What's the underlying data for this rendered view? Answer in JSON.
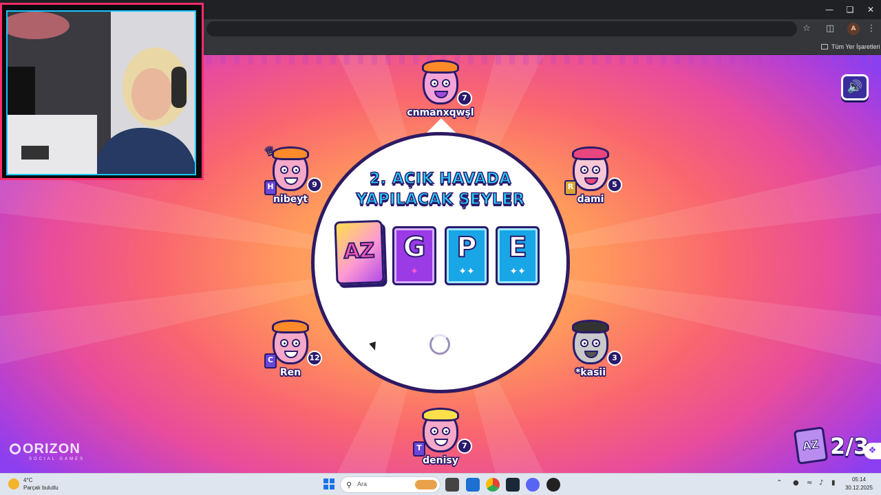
{
  "browser": {
    "bookmarks_label": "Tüm Yer İşaretleri",
    "profile_initial": "A"
  },
  "game": {
    "prompt_line1": "2. AÇIK HAVADA",
    "prompt_line2": "YAPILACAK ŞEYLER",
    "cards": [
      {
        "letter": "AZ",
        "stars": ""
      },
      {
        "letter": "G",
        "stars": "✦"
      },
      {
        "letter": "P",
        "stars": "✦✦"
      },
      {
        "letter": "E",
        "stars": "✦✦"
      }
    ],
    "players": [
      {
        "name": "cnmanxqwşl",
        "score": "7",
        "tile": ""
      },
      {
        "name": "nibeyt",
        "score": "9",
        "tile": "H"
      },
      {
        "name": "dami",
        "score": "5",
        "tile": "R"
      },
      {
        "name": "Ren",
        "score": "12",
        "tile": "C"
      },
      {
        "name": "*kasii",
        "score": "3",
        "tile": ""
      },
      {
        "name": "denisy",
        "score": "7",
        "tile": "T"
      }
    ],
    "round_icon": "AZ",
    "round_text": "2/3",
    "logo_text": "ORIZON",
    "logo_sub": "SOCIAL GAMES",
    "accent": "#2ad0ff",
    "outline": "#2a1a6b"
  },
  "taskbar": {
    "weather_temp": "4°C",
    "weather_desc": "Parçalı bulutlu",
    "search_placeholder": "Ara",
    "time": "05:14",
    "date": "30.12.2025"
  }
}
